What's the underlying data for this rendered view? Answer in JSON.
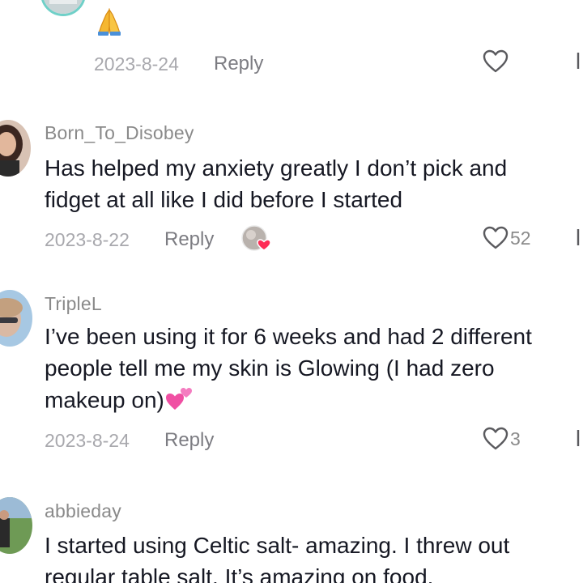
{
  "comments": [
    {
      "body": "🙏",
      "date": "2023-8-24",
      "reply_label": "Reply",
      "likes": ""
    },
    {
      "username": "Born_To_Disobey",
      "body_lines": [
        "Has helped my anxiety greatly I don’t pick and",
        "fidget at all like I did before I started"
      ],
      "date": "2023-8-22",
      "reply_label": "Reply",
      "likes": "52"
    },
    {
      "username": "TripleL",
      "body_lines": [
        "I’ve been using it for 6 weeks and had 2 different",
        "people tell me my skin is Glowing (I had zero",
        "makeup on)"
      ],
      "date": "2023-8-24",
      "reply_label": "Reply",
      "likes": "3"
    },
    {
      "username": "abbieday",
      "body_lines": [
        "I started using Celtic salt- amazing. I threw out",
        "regular table salt. It’s amazing on food."
      ]
    }
  ],
  "icons": {
    "like": "heart-outline-icon",
    "dislike": "thumbs-down-outline-icon",
    "creator_liked": "creator-liked-heart-badge",
    "emoji_pray": "folded-hands-emoji",
    "emoji_hearts": "two-hearts-emoji"
  },
  "colors": {
    "username": "#8a8a8a",
    "text": "#161823",
    "meta": "#a8a8ad",
    "heart_badge": "#fe2c55"
  }
}
